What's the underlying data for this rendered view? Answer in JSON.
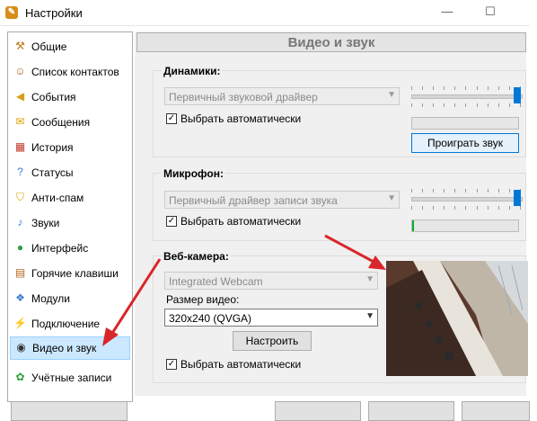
{
  "window": {
    "title": "Настройки",
    "app_icon": "app-icon"
  },
  "sidebar": {
    "items": [
      {
        "label": "Общие",
        "icon": "tools-icon"
      },
      {
        "label": "Список контактов",
        "icon": "contacts-icon"
      },
      {
        "label": "События",
        "icon": "bell-icon"
      },
      {
        "label": "Сообщения",
        "icon": "chat-icon"
      },
      {
        "label": "История",
        "icon": "calendar-icon"
      },
      {
        "label": "Статусы",
        "icon": "question-icon"
      },
      {
        "label": "Анти-спам",
        "icon": "shield-icon"
      },
      {
        "label": "Звуки",
        "icon": "music-note-icon"
      },
      {
        "label": "Интерфейс",
        "icon": "palette-icon"
      },
      {
        "label": "Горячие клавиши",
        "icon": "keyboard-icon"
      },
      {
        "label": "Модули",
        "icon": "modules-icon"
      },
      {
        "label": "Подключение",
        "icon": "plug-icon"
      },
      {
        "label": "Видео и звук",
        "icon": "camera-icon",
        "active": true
      },
      {
        "label": "Учётные записи",
        "icon": "accounts-icon"
      }
    ]
  },
  "header": {
    "title": "Видео и звук"
  },
  "speakers": {
    "title": "Динамики:",
    "device": "Первичный звуковой драйвер",
    "auto_label": "Выбрать автоматически",
    "auto_checked": true,
    "volume": 1.0,
    "play_button": "Проиграть звук"
  },
  "microphone": {
    "title": "Микрофон:",
    "device": "Первичный драйвер записи звука",
    "auto_label": "Выбрать автоматически",
    "auto_checked": true,
    "volume": 1.0,
    "level": 0.02
  },
  "webcam": {
    "title": "Веб-камера:",
    "device": "Integrated Webcam",
    "size_label": "Размер видео:",
    "size_value": "320x240 (QVGA)",
    "configure_button": "Настроить",
    "auto_label": "Выбрать автоматически",
    "auto_checked": true
  },
  "colors": {
    "accent": "#0078d7",
    "annotation_arrow": "#d9262a",
    "level": "#06b025"
  }
}
